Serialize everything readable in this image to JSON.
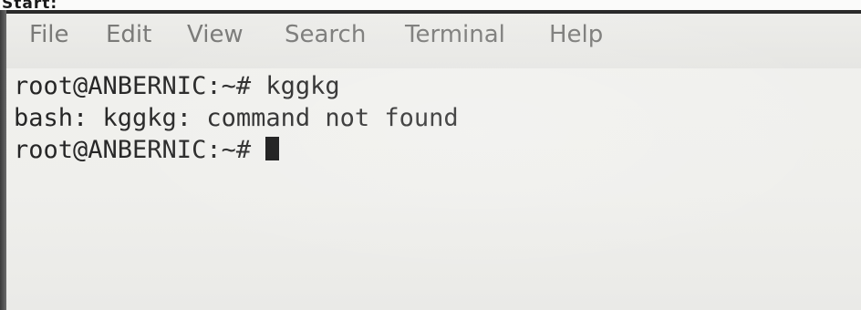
{
  "overlay": {
    "cropped_text": "Start:"
  },
  "menubar": {
    "items": [
      {
        "label": "File"
      },
      {
        "label": "Edit"
      },
      {
        "label": "View"
      },
      {
        "label": "Search"
      },
      {
        "label": "Terminal"
      },
      {
        "label": "Help"
      }
    ]
  },
  "terminal": {
    "lines": [
      {
        "text": "root@ANBERNIC:~# kggkg"
      },
      {
        "text": "bash: kggkg: command not found"
      },
      {
        "text": "root@ANBERNIC:~# "
      }
    ]
  },
  "colors": {
    "screen_background": "#f1f1ee",
    "menu_text": "#7a7a78",
    "terminal_text": "#262626",
    "cursor": "#111111",
    "bezel": "#2a2a2a"
  }
}
